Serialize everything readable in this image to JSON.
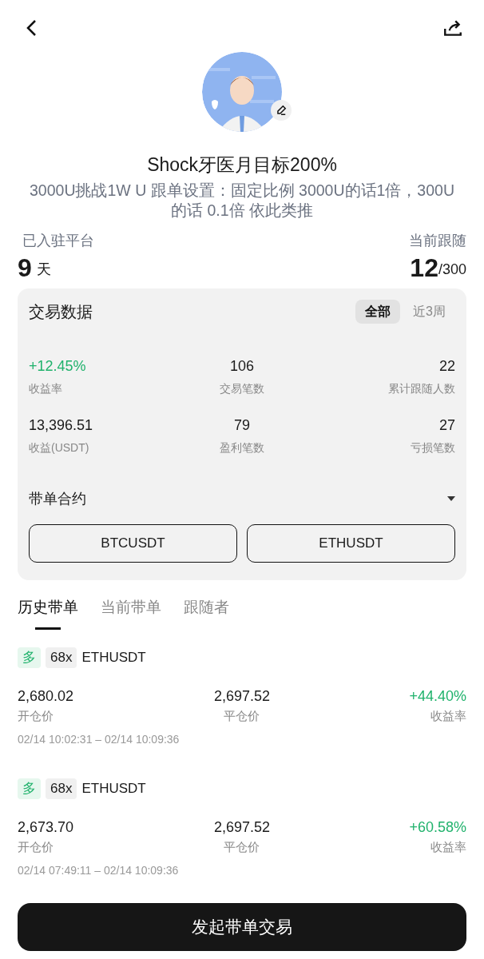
{
  "profile": {
    "name": "Shock牙医月目标200%",
    "description": "3000U挑战1W U  跟单设置：固定比例 3000U的话1倍，300U的话 0.1倍 依此类推"
  },
  "summary": {
    "left_label": "已入驻平台",
    "left_value": "9",
    "left_unit": "天",
    "right_label": "当前跟随",
    "right_value": "12",
    "right_total": "/300"
  },
  "trade_data": {
    "title": "交易数据",
    "periods": [
      {
        "label": "全部",
        "selected": true
      },
      {
        "label": "近3周",
        "selected": false
      }
    ],
    "stats": [
      {
        "value": "+12.45%",
        "label": "收益率",
        "kind": "gain"
      },
      {
        "value": "106",
        "label": "交易笔数",
        "kind": "plain"
      },
      {
        "value": "22",
        "label": "累计跟随人数",
        "kind": "plain"
      },
      {
        "value": "13,396.51",
        "label": "收益(USDT)",
        "kind": "plain"
      },
      {
        "value": "79",
        "label": "盈利笔数",
        "kind": "plain"
      },
      {
        "value": "27",
        "label": "亏损笔数",
        "kind": "plain"
      }
    ],
    "contracts_title": "带单合约",
    "contracts": [
      "BTCUSDT",
      "ETHUSDT"
    ]
  },
  "tabs": [
    {
      "label": "历史带单",
      "selected": true
    },
    {
      "label": "当前带单",
      "selected": false
    },
    {
      "label": "跟随者",
      "selected": false
    }
  ],
  "orders": [
    {
      "side": "多",
      "leverage": "68x",
      "symbol": "ETHUSDT",
      "open_price": "2,680.02",
      "open_label": "开仓价",
      "close_price": "2,697.52",
      "close_label": "平仓价",
      "roi": "+44.40%",
      "roi_label": "收益率",
      "time": "02/14 10:02:31 – 02/14 10:09:36"
    },
    {
      "side": "多",
      "leverage": "68x",
      "symbol": "ETHUSDT",
      "open_price": "2,673.70",
      "open_label": "开仓价",
      "close_price": "2,697.52",
      "close_label": "平仓价",
      "roi": "+60.58%",
      "roi_label": "收益率",
      "time": "02/14 07:49:11 – 02/14 10:09:36"
    }
  ],
  "action_button": "发起带单交易"
}
